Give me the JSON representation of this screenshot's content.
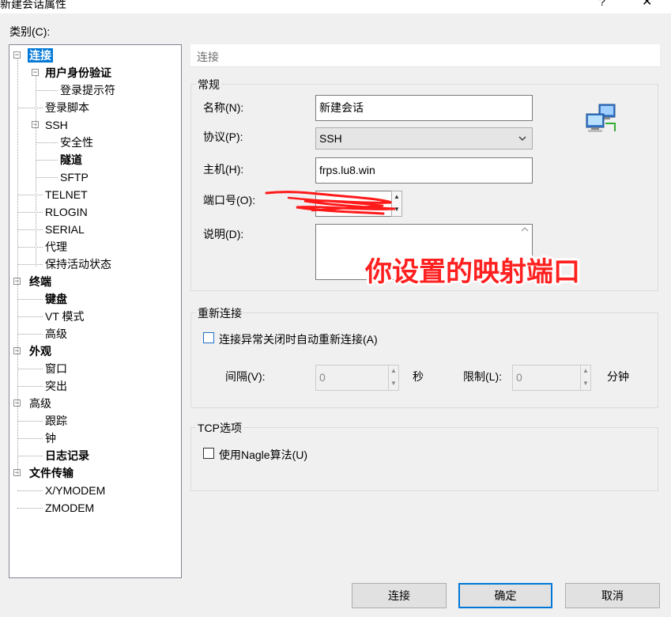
{
  "window": {
    "title": "新建会话属性",
    "help_glyph": "?",
    "close_glyph": "✕"
  },
  "category_label": "类别(C):",
  "tree": {
    "items": [
      {
        "label": "连接",
        "level": 0,
        "bold": true,
        "selected": true,
        "toggle": "−"
      },
      {
        "label": "用户身份验证",
        "level": 1,
        "bold": true,
        "toggle": "−"
      },
      {
        "label": "登录提示符",
        "level": 2
      },
      {
        "label": "登录脚本",
        "level": 1
      },
      {
        "label": "SSH",
        "level": 1,
        "toggle": "−"
      },
      {
        "label": "安全性",
        "level": 2
      },
      {
        "label": "隧道",
        "level": 2,
        "bold": true
      },
      {
        "label": "SFTP",
        "level": 2
      },
      {
        "label": "TELNET",
        "level": 1
      },
      {
        "label": "RLOGIN",
        "level": 1
      },
      {
        "label": "SERIAL",
        "level": 1
      },
      {
        "label": "代理",
        "level": 1
      },
      {
        "label": "保持活动状态",
        "level": 1
      },
      {
        "label": "终端",
        "level": 0,
        "bold": true,
        "toggle": "−"
      },
      {
        "label": "键盘",
        "level": 1,
        "bold": true
      },
      {
        "label": "VT 模式",
        "level": 1
      },
      {
        "label": "高级",
        "level": 1
      },
      {
        "label": "外观",
        "level": 0,
        "bold": true,
        "toggle": "−"
      },
      {
        "label": "窗口",
        "level": 1
      },
      {
        "label": "突出",
        "level": 1
      },
      {
        "label": "高级",
        "level": 0,
        "toggle": "−"
      },
      {
        "label": "跟踪",
        "level": 1
      },
      {
        "label": "钟",
        "level": 1
      },
      {
        "label": "日志记录",
        "level": 1,
        "bold": true
      },
      {
        "label": "文件传输",
        "level": 0,
        "bold": true,
        "toggle": "−"
      },
      {
        "label": "X/YMODEM",
        "level": 1
      },
      {
        "label": "ZMODEM",
        "level": 1
      }
    ]
  },
  "section_header": "连接",
  "general": {
    "title": "常规",
    "name_label": "名称(N):",
    "name_value": "新建会话",
    "protocol_label": "协议(P):",
    "protocol_value": "SSH",
    "host_label": "主机(H):",
    "host_value": "frps.lu8.win",
    "port_label": "端口号(O):",
    "desc_label": "说明(D):"
  },
  "annotation": "你设置的映射端口",
  "reconnect": {
    "title": "重新连接",
    "auto_reconnect_label": "连接异常关闭时自动重新连接(A)",
    "interval_label": "间隔(V):",
    "interval_value": "0",
    "seconds_unit": "秒",
    "limit_label": "限制(L):",
    "limit_value": "0",
    "minutes_unit": "分钟"
  },
  "tcp": {
    "title": "TCP选项",
    "nagle_label": "使用Nagle算法(U)"
  },
  "buttons": {
    "connect": "连接",
    "ok": "确定",
    "cancel": "取消"
  }
}
